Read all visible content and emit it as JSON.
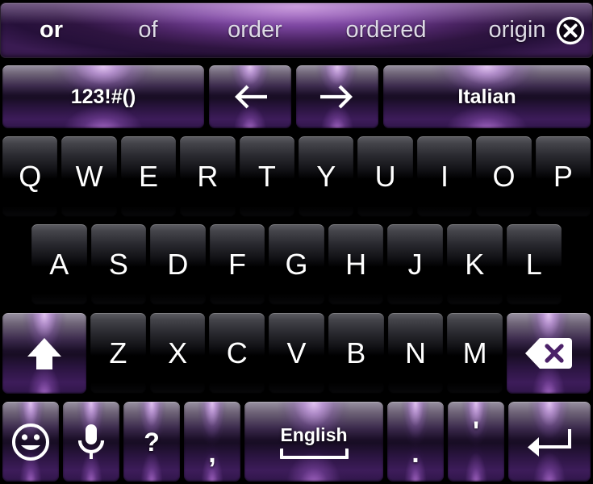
{
  "app": {
    "name": "on-screen-keyboard",
    "theme_accent": "#8a4fbf",
    "background": "#000000"
  },
  "suggestions": {
    "items": [
      {
        "text": "or",
        "active": true
      },
      {
        "text": "of",
        "active": false
      },
      {
        "text": "order",
        "active": false
      },
      {
        "text": "ordered",
        "active": false
      },
      {
        "text": "origin",
        "active": false
      }
    ],
    "close_icon": "close-circle-icon"
  },
  "function_row": [
    {
      "id": "symbols",
      "label": "123!#()",
      "type": "text"
    },
    {
      "id": "arrow-left",
      "label": "←",
      "type": "icon",
      "icon": "arrow-left-icon"
    },
    {
      "id": "arrow-right",
      "label": "→",
      "type": "icon",
      "icon": "arrow-right-icon"
    },
    {
      "id": "language",
      "label": "Italian",
      "type": "text"
    }
  ],
  "rows": {
    "row1": [
      "Q",
      "W",
      "E",
      "R",
      "T",
      "Y",
      "U",
      "I",
      "O",
      "P"
    ],
    "row2": [
      "A",
      "S",
      "D",
      "F",
      "G",
      "H",
      "J",
      "K",
      "L"
    ],
    "row3": [
      "Z",
      "X",
      "C",
      "V",
      "B",
      "N",
      "M"
    ]
  },
  "modifier_keys": {
    "shift": {
      "icon": "shift-arrow-up-icon",
      "label": ""
    },
    "backspace": {
      "icon": "backspace-delete-icon",
      "label": ""
    }
  },
  "bottom_row": {
    "emoji": {
      "icon": "smiley-face-icon",
      "label": ""
    },
    "mic": {
      "icon": "microphone-icon",
      "label": ""
    },
    "question": {
      "label": "?"
    },
    "comma": {
      "label": ","
    },
    "space": {
      "label": "English",
      "icon": "spacebar-bracket-icon"
    },
    "period": {
      "label": "."
    },
    "apostrophe": {
      "label": "'"
    },
    "enter": {
      "icon": "enter-return-icon",
      "label": ""
    }
  }
}
